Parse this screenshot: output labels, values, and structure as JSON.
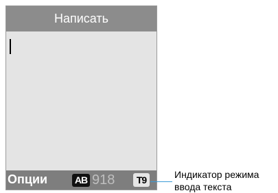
{
  "header": {
    "title": "Написать"
  },
  "softkeys": {
    "left_label": "Опции",
    "input_mode": "AB",
    "char_count": "918",
    "predictive_mode": "T9"
  },
  "callout": {
    "line1": "Индикатор режима",
    "line2": "ввода текста"
  }
}
